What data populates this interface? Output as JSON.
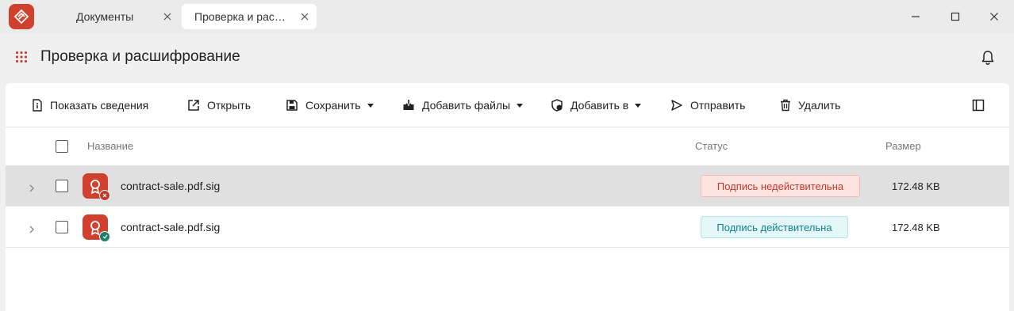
{
  "window": {
    "tabs": [
      {
        "label": "Документы",
        "active": false
      },
      {
        "label": "Проверка и расшифрование",
        "active": true
      }
    ]
  },
  "header": {
    "title": "Проверка и расшифрование"
  },
  "toolbar": {
    "show_info": "Показать сведения",
    "open": "Открыть",
    "save": "Сохранить",
    "add_files": "Добавить файлы",
    "add_to": "Добавить в",
    "send": "Отправить",
    "delete": "Удалить"
  },
  "table": {
    "columns": {
      "name": "Название",
      "status": "Статус",
      "size": "Размер"
    },
    "rows": [
      {
        "name": "contract-sale.pdf.sig",
        "status": "Подпись недействительна",
        "status_kind": "invalid",
        "size": "172.48 KB",
        "selected": true
      },
      {
        "name": "contract-sale.pdf.sig",
        "status": "Подпись действительна",
        "status_kind": "valid",
        "size": "172.48 KB",
        "selected": false
      }
    ]
  },
  "colors": {
    "accent": "#d0402f",
    "invalid_bg": "#fde4e1",
    "invalid_text": "#c0392b",
    "valid_bg": "#e3f6f8",
    "valid_text": "#12808a",
    "valid_badge": "#1a7f6b"
  },
  "icons": [
    "app-logo",
    "close-icon",
    "minimize-icon",
    "maximize-icon",
    "apps-grid-icon",
    "bell-icon",
    "info-icon",
    "open-external-icon",
    "save-icon",
    "add-files-icon",
    "add-to-icon",
    "send-icon",
    "trash-icon",
    "panel-toggle-icon",
    "chevron-right-icon",
    "certificate-icon"
  ]
}
